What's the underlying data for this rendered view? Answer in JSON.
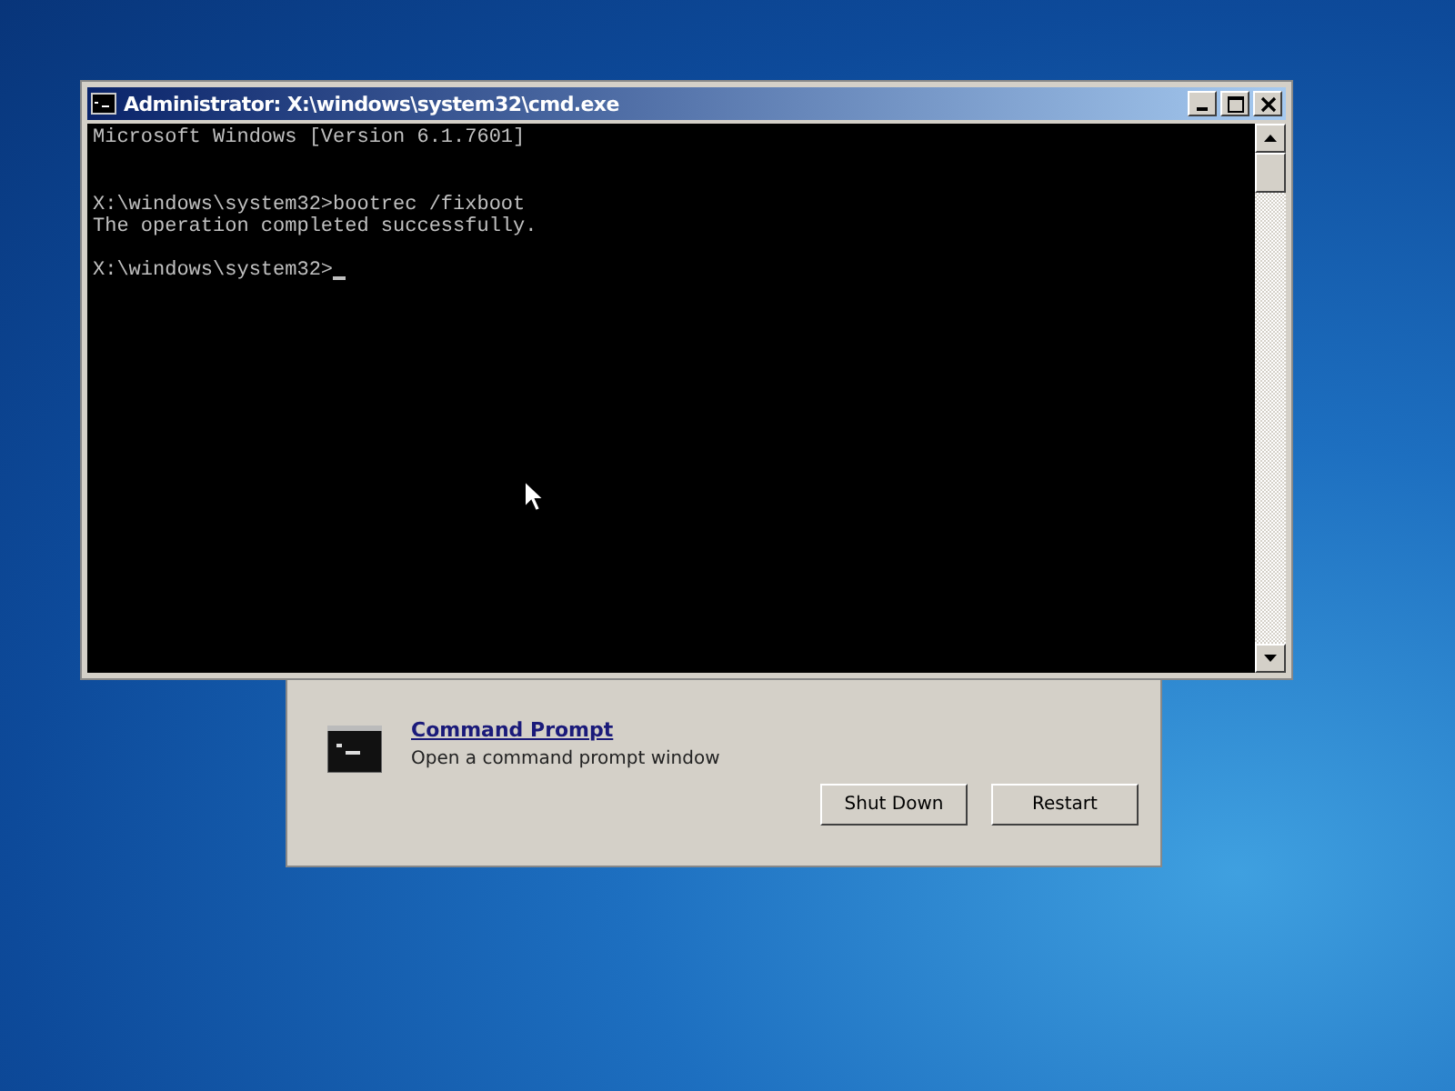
{
  "console_window": {
    "title": "Administrator: X:\\windows\\system32\\cmd.exe",
    "lines": [
      {
        "kind": "text",
        "text": "Microsoft Windows [Version 6.1.7601]"
      },
      {
        "kind": "blank"
      },
      {
        "kind": "blank"
      },
      {
        "kind": "text",
        "text": "X:\\windows\\system32>bootrec /fixboot"
      },
      {
        "kind": "text",
        "text": "The operation completed successfully."
      },
      {
        "kind": "blank"
      },
      {
        "kind": "prompt",
        "text": "X:\\windows\\system32>",
        "cursor": true
      }
    ]
  },
  "recovery_dialog": {
    "option": {
      "link": "Command Prompt",
      "description": "Open a command prompt window"
    },
    "buttons": [
      "Shut Down",
      "Restart"
    ]
  }
}
